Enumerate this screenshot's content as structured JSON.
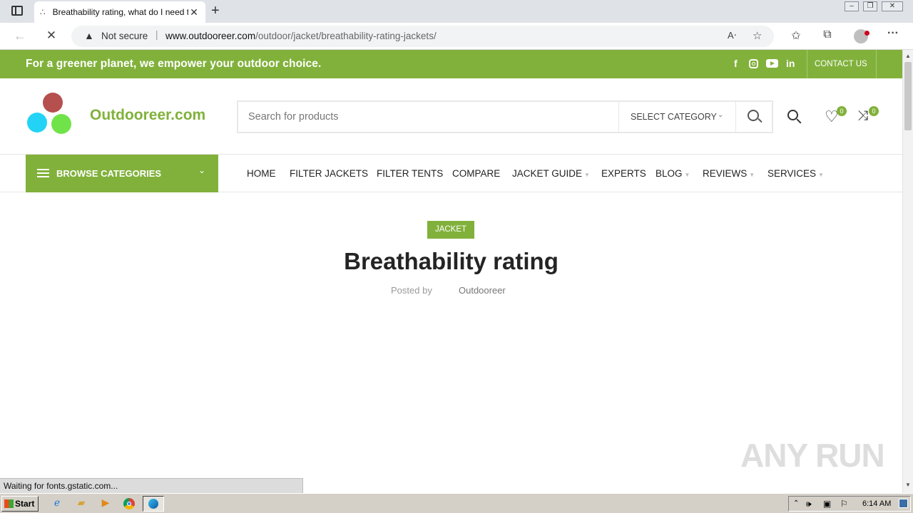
{
  "browser": {
    "tab_title": "Breathability rating, what do I need to know?",
    "security_label": "Not secure",
    "url_domain": "www.outdooreer.com",
    "url_path": "/outdoor/jacket/breathability-rating-jackets/",
    "status_text": "Waiting for fonts.gstatic.com..."
  },
  "topbar": {
    "tagline": "For a greener planet, we empower your outdoor choice.",
    "contact_label": "CONTACT US",
    "social_icons": [
      "facebook-icon",
      "instagram-icon",
      "youtube-icon",
      "linkedin-icon"
    ]
  },
  "header": {
    "logo_text": "Outdooreer.com",
    "search_placeholder": "Search for products",
    "category_select": "SELECT CATEGORY",
    "wishlist_count": "0",
    "compare_count": "0"
  },
  "nav": {
    "browse_label": "BROWSE CATEGORIES",
    "items": [
      {
        "label": "HOME"
      },
      {
        "label": "FILTER JACKETS"
      },
      {
        "label": "FILTER TENTS"
      },
      {
        "label": "COMPARE"
      },
      {
        "label": "JACKET GUIDE"
      },
      {
        "label": "EXPERTS"
      },
      {
        "label": "BLOG"
      },
      {
        "label": "REVIEWS"
      },
      {
        "label": "SERVICES"
      }
    ]
  },
  "article": {
    "category_badge": "JACKET",
    "title": "Breathability rating",
    "posted_by_label": "Posted by",
    "author": "Outdooreer"
  },
  "watermark": "ANY RUN",
  "taskbar": {
    "start_label": "Start",
    "clock": "6:14 AM"
  },
  "colors": {
    "brand_green": "#81b13b",
    "logo_red": "#b5504e",
    "logo_cyan": "#23d3f5",
    "logo_green": "#71e34a"
  }
}
